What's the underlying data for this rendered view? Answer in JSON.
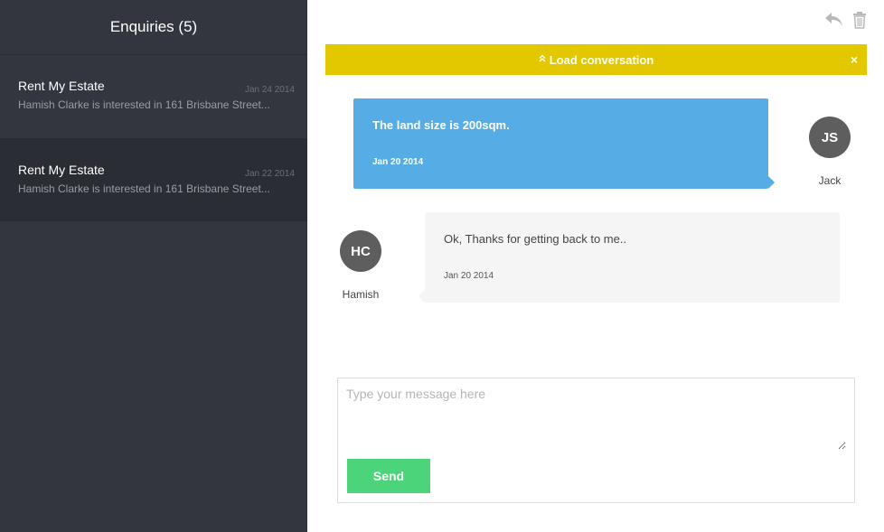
{
  "sidebar": {
    "title": "Enquiries (5)",
    "enquiries": [
      {
        "title": "Rent My Estate",
        "date": "Jan 24 2014",
        "preview": "Hamish Clarke is interested in 161 Brisbane Street..."
      },
      {
        "title": "Rent My Estate",
        "date": "Jan 22 2014",
        "preview": "Hamish Clarke is interested in 161 Brisbane Street..."
      }
    ]
  },
  "toolbar": {
    "reply_icon": "reply-icon",
    "trash_icon": "trash-icon"
  },
  "banner": {
    "label": "Load conversation",
    "chevron": "«",
    "close": "×",
    "color": "#e3c800"
  },
  "messages": [
    {
      "text": "The land size is 200sqm.",
      "date": "Jan 20 2014",
      "initials": "JS",
      "name": "Jack",
      "color": "#56ade6"
    },
    {
      "text": "Ok, Thanks for getting back to me..",
      "date": "Jan 20 2014",
      "initials": "HC",
      "name": "Hamish",
      "color": "#f5f5f5"
    }
  ],
  "composer": {
    "placeholder": "Type your message here",
    "value": "",
    "send_label": "Send",
    "send_color": "#4cd47a"
  }
}
